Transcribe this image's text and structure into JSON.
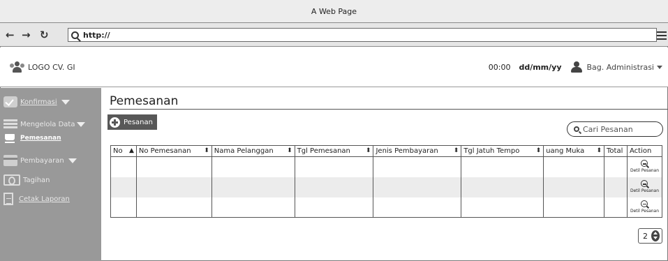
{
  "window": {
    "title": "A Web Page"
  },
  "browser": {
    "back_icon": "back-arrow-icon",
    "forward_icon": "forward-arrow-icon",
    "reload_icon": "reload-icon",
    "url": "http://",
    "menu_icon": "hamburger-icon"
  },
  "header": {
    "logo_text": "LOGO CV. GI",
    "time": "00:00",
    "date": "dd/mm/yy",
    "user_label": "Bag. Administrasi"
  },
  "sidebar": {
    "items": [
      {
        "label": "Konfirmasi",
        "icon": "check-icon",
        "has_dropdown": true
      },
      {
        "label": "Mengelola Data",
        "icon": "list-icon",
        "has_dropdown": true
      },
      {
        "label": "Pemesanan",
        "icon": "cart-icon",
        "active": true
      },
      {
        "label": "Pembayaran",
        "icon": "card-icon",
        "has_dropdown": true
      },
      {
        "label": "Tagihan",
        "icon": "money-icon"
      },
      {
        "label": "Cetak Laporan",
        "icon": "document-icon"
      }
    ]
  },
  "main": {
    "title": "Pemesanan",
    "add_button_label": "Pesanan",
    "search_placeholder": "Cari Pesanan",
    "table": {
      "columns": [
        "No",
        "No Pemesanan",
        "Nama Pelanggan",
        "Tgl Pemesanan",
        "Jenis Pembayaran",
        "Tgl Jatuh Tempo",
        "uang Muka",
        "Total",
        "Action"
      ],
      "detail_label": "Detil Pesanan"
    },
    "pagination": {
      "current_page": "2"
    }
  }
}
